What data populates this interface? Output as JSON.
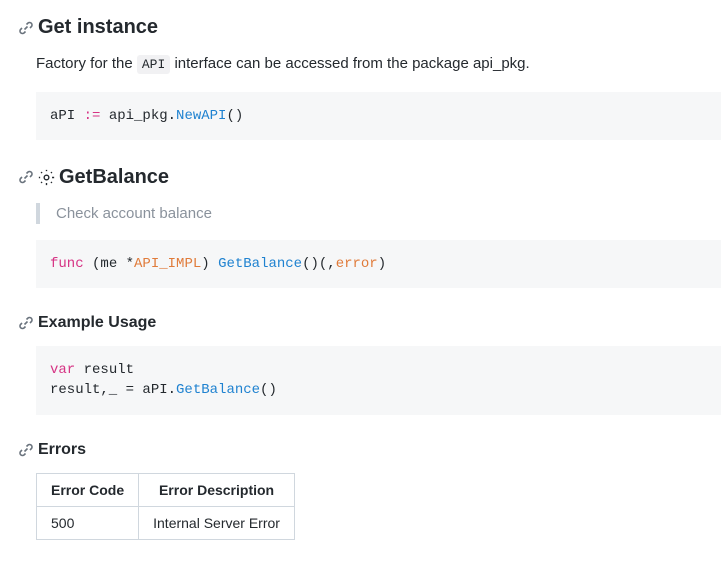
{
  "sections": {
    "get_instance": {
      "title": "Get instance",
      "desc_before": "Factory for the ",
      "desc_code": "API",
      "desc_after": " interface can be accessed from the package api_pkg.",
      "code": {
        "t1": "aPI ",
        "op": ":=",
        "t2": " api_pkg.",
        "fn": "NewAPI",
        "t3": "()"
      }
    },
    "get_balance": {
      "title": "GetBalance",
      "quote": "Check account balance",
      "code": {
        "kw": "func",
        "t1": " (",
        "t2": "me *",
        "type": "API_IMPL",
        "t3": ") ",
        "fn": "GetBalance",
        "t4": "()(,",
        "err": "error",
        "t5": ")"
      }
    },
    "example": {
      "title": "Example Usage",
      "code": {
        "kw": "var",
        "t1": " result ",
        "t2": "result,_ = aPI.",
        "fn": "GetBalance",
        "t3": "()"
      }
    },
    "errors": {
      "title": "Errors",
      "table": {
        "head": {
          "c1": "Error Code",
          "c2": "Error Description"
        },
        "rows": [
          {
            "code": "500",
            "desc": "Internal Server Error"
          }
        ]
      }
    }
  }
}
